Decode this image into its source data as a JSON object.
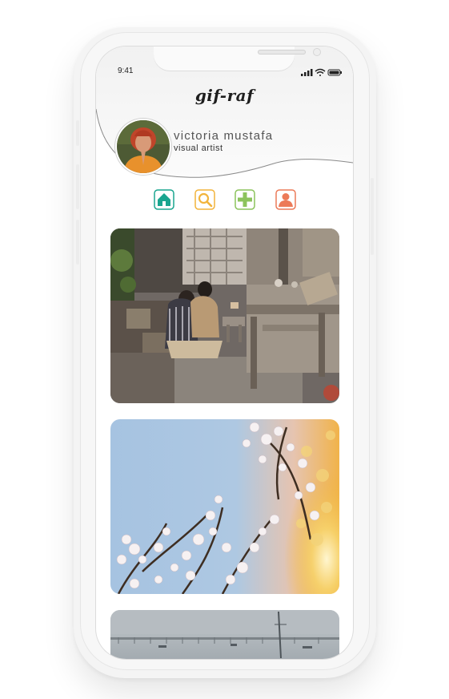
{
  "status_bar": {
    "time": "9:41",
    "signal_icon": "signal-icon",
    "wifi_icon": "wifi-icon",
    "battery_icon": "battery-icon"
  },
  "app": {
    "title": "gif-raf"
  },
  "profile": {
    "name": "victoria mustafa",
    "role": "visual artist"
  },
  "nav": [
    {
      "icon": "home-icon",
      "color": "#1aa58f"
    },
    {
      "icon": "search-icon",
      "color": "#f2b43c"
    },
    {
      "icon": "add-icon",
      "color": "#8cc35c"
    },
    {
      "icon": "profile-icon",
      "color": "#ec7a58"
    }
  ],
  "colors": {
    "background": "#ffffff",
    "frame": "#f7f7f7",
    "title_text": "#1e1e1e"
  }
}
